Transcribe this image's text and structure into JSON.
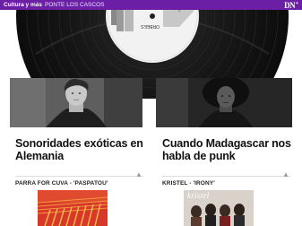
{
  "topbar": {
    "section": "Cultura y más",
    "article": "PONTE LOS CASCOS",
    "logo_main": "DN",
    "logo_plus": "+",
    "color": "#6a1fa4"
  },
  "hero": {
    "record_label_text": "ORBEES"
  },
  "stories": [
    {
      "headline": "Sonoridades exóticas en Alemania",
      "track": "PARRA FOR CUVA - 'PASPATOU'"
    },
    {
      "headline": "Cuando Madagascar nos habla de punk",
      "track": "KRISTEL - 'IRONY'",
      "cover_title": "kristel"
    }
  ],
  "icons": {
    "scroll_up": "▲"
  }
}
